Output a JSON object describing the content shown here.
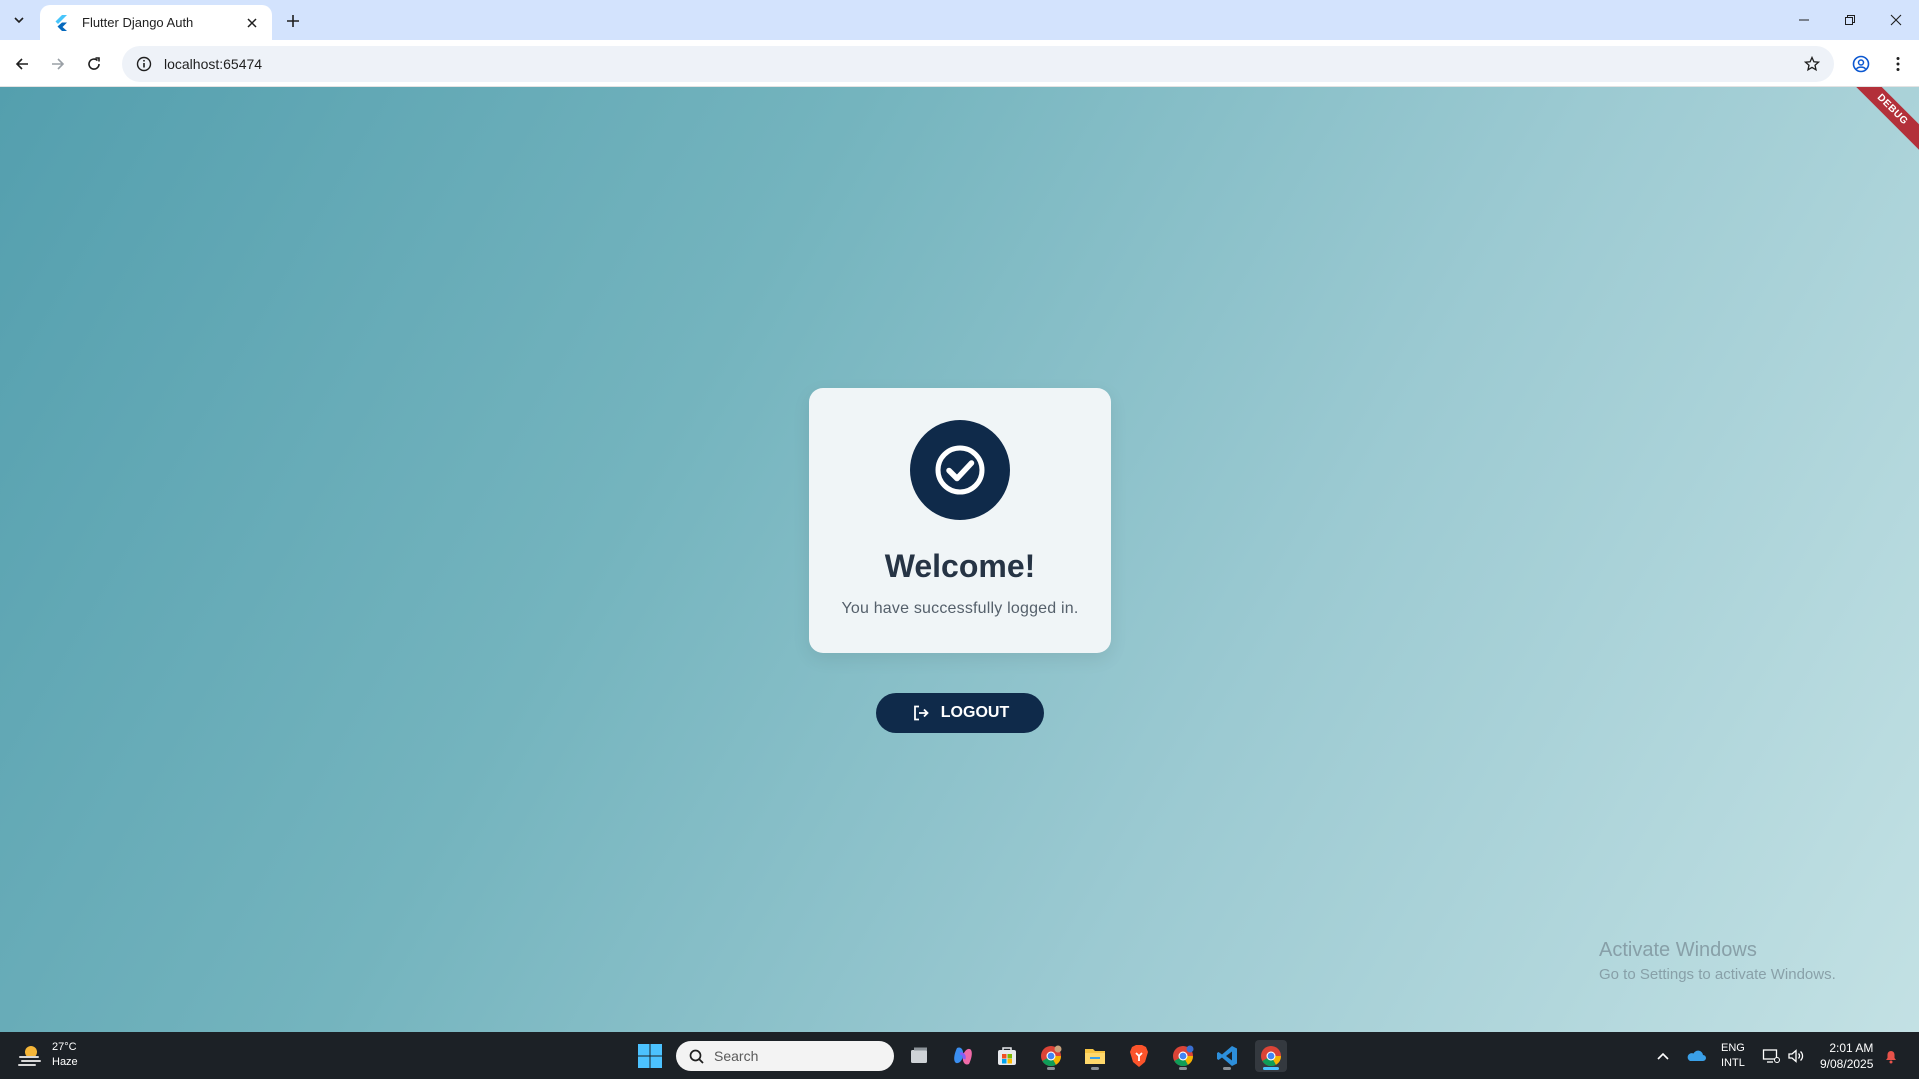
{
  "browser": {
    "tab_title": "Flutter Django Auth",
    "url": "localhost:65474"
  },
  "app": {
    "debug_banner": "DEBUG",
    "welcome_title": "Welcome!",
    "welcome_subtitle": "You have successfully logged in.",
    "logout_label": "LOGOUT",
    "colors": {
      "primary": "#0f2a4a",
      "card": "#f0f5f7",
      "gradient_start": "#549fae",
      "gradient_end": "#c3e1e4"
    }
  },
  "watermark": {
    "line1": "Activate Windows",
    "line2": "Go to Settings to activate Windows."
  },
  "taskbar": {
    "weather_temp": "27°C",
    "weather_desc": "Haze",
    "search_placeholder": "Search",
    "lang_top": "ENG",
    "lang_bottom": "INTL",
    "time": "2:01 AM",
    "date": "9/08/2025",
    "apps": [
      "task-view",
      "copilot",
      "microsoft-store",
      "chrome-profile-1",
      "file-explorer",
      "brave",
      "chrome-profile-2",
      "vscode",
      "chrome"
    ]
  }
}
